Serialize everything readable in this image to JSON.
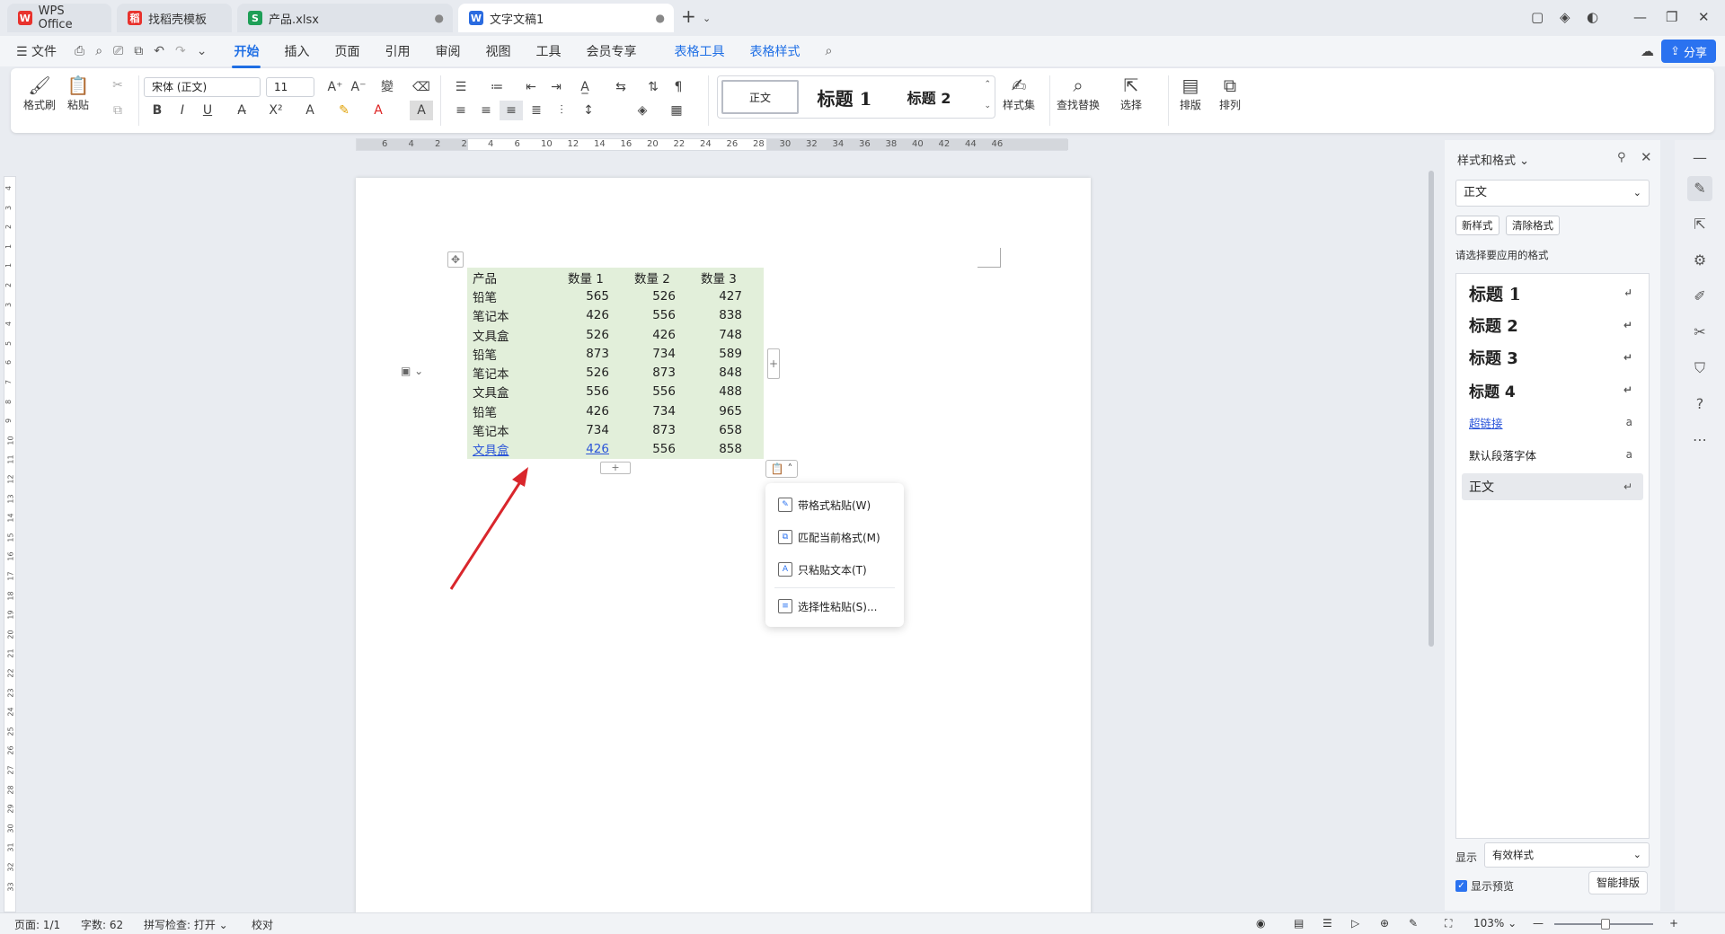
{
  "tabs": [
    {
      "label": "WPS Office",
      "icon": "wps-logo-icon",
      "active": false
    },
    {
      "label": "找稻壳模板",
      "icon": "daoke-icon",
      "active": false
    },
    {
      "label": "产品.xlsx",
      "icon": "spreadsheet-icon",
      "active": false
    },
    {
      "label": "文字文稿1",
      "icon": "writer-icon",
      "active": true
    }
  ],
  "menu": {
    "file": "文件",
    "items": [
      "开始",
      "插入",
      "页面",
      "引用",
      "审阅",
      "视图",
      "工具",
      "会员专享"
    ],
    "context_items": [
      "表格工具",
      "表格样式"
    ],
    "active": "开始",
    "share": "分享"
  },
  "ribbon": {
    "format_painter": "格式刷",
    "paste": "粘贴",
    "font_name": "宋体 (正文)",
    "font_size": "11",
    "style_gallery": [
      "正文",
      "标题 1",
      "标题 2"
    ],
    "style_set": "样式集",
    "find_replace": "查找替换",
    "select": "选择",
    "layout": "排版",
    "arrange": "排列"
  },
  "ruler_ticks": [
    "6",
    "4",
    "2",
    "2",
    "4",
    "6",
    "10",
    "12",
    "14",
    "16",
    "20",
    "22",
    "24",
    "26",
    "28",
    "30",
    "32",
    "34",
    "36",
    "38",
    "40",
    "42",
    "44",
    "46"
  ],
  "vruler_ticks": [
    "4",
    "3",
    "2",
    "1",
    "1",
    "2",
    "3",
    "4",
    "5",
    "6",
    "7",
    "8",
    "9",
    "10",
    "11",
    "12",
    "13",
    "14",
    "15",
    "16",
    "17",
    "18",
    "19",
    "20",
    "21",
    "22",
    "23",
    "24",
    "25",
    "26",
    "27",
    "28",
    "29",
    "30",
    "31",
    "32",
    "33"
  ],
  "table": {
    "headers": [
      "产品",
      "数量 1",
      "数量 2",
      "数量 3"
    ],
    "rows": [
      [
        "铅笔",
        "565",
        "526",
        "427"
      ],
      [
        "笔记本",
        "426",
        "556",
        "838"
      ],
      [
        "文具盒",
        "526",
        "426",
        "748"
      ],
      [
        "铅笔",
        "873",
        "734",
        "589"
      ],
      [
        "笔记本",
        "526",
        "873",
        "848"
      ],
      [
        "文具盒",
        "556",
        "556",
        "488"
      ],
      [
        "铅笔",
        "426",
        "734",
        "965"
      ],
      [
        "笔记本",
        "734",
        "873",
        "658"
      ],
      [
        "文具盒",
        "426",
        "556",
        "858"
      ]
    ],
    "bg_color": "#e2efda"
  },
  "paste_menu": {
    "items": [
      "带格式粘贴(W)",
      "匹配当前格式(M)",
      "只粘贴文本(T)",
      "选择性粘贴(S)..."
    ]
  },
  "panel": {
    "title": "样式和格式",
    "current_style": "正文",
    "new_style": "新样式",
    "clear_format": "清除格式",
    "apply_label": "请选择要应用的格式",
    "styles": [
      "标题 1",
      "标题 2",
      "标题 3",
      "标题 4",
      "超链接",
      "默认段落字体",
      "正文"
    ],
    "show_label": "显示",
    "show_value": "有效样式",
    "preview_label": "显示预览",
    "smart_layout": "智能排版"
  },
  "status": {
    "page": "页面: 1/1",
    "words": "字数: 62",
    "spellcheck": "拼写检查: 打开",
    "proofread": "校对",
    "zoom": "103%"
  },
  "colors": {
    "accent": "#1f6fe5",
    "arrow": "#d9262c",
    "table_fill": "#e2efda"
  }
}
